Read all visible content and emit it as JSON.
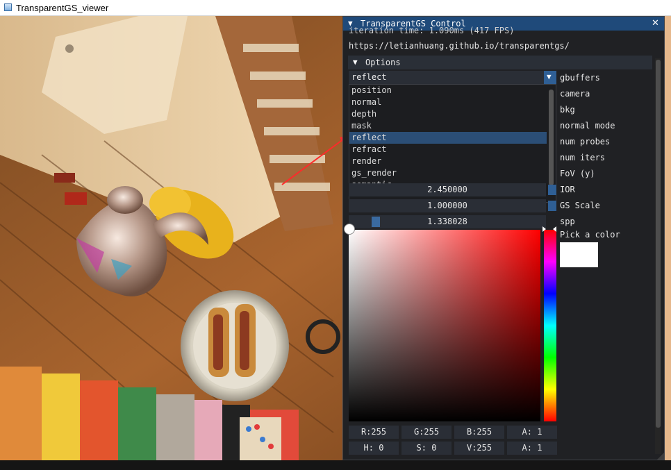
{
  "window": {
    "title": "TransparentGS_viewer"
  },
  "panel": {
    "title": "TransparentGS Control",
    "frame_info": "iteration time: 1.090ms (417 FPS)",
    "url": "https://letianhuang.github.io/transparentgs/",
    "options_header": "Options",
    "combo_value": "reflect",
    "dropdown_items": [
      "position",
      "normal",
      "depth",
      "mask",
      "reflect",
      "refract",
      "render",
      "gs_render",
      "semantic"
    ],
    "selected_item": "reflect",
    "labels": [
      "gbuffers",
      "camera",
      "bkg",
      "normal mode",
      "num probes",
      "num iters",
      "FoV (y)",
      "IOR",
      "GS Scale",
      "spp"
    ],
    "sliders": {
      "ior": "2.450000",
      "gs_scale": "1.000000",
      "spp": "1.338028"
    },
    "color": {
      "pick_label": "Pick a color",
      "swatch": "#ffffff",
      "rgba": [
        "R:255",
        "G:255",
        "B:255",
        "A:  1"
      ],
      "hsva": [
        "H:  0",
        "S:  0",
        "V:255",
        "A:  1"
      ]
    }
  },
  "icons": [
    "app-icon",
    "collapse-arrow-icon",
    "close-icon",
    "combo-arrow-icon"
  ],
  "colors": {
    "title_bar": "#1f4a7a",
    "selection": "#2b4e76",
    "panel_bg": "#202124"
  }
}
